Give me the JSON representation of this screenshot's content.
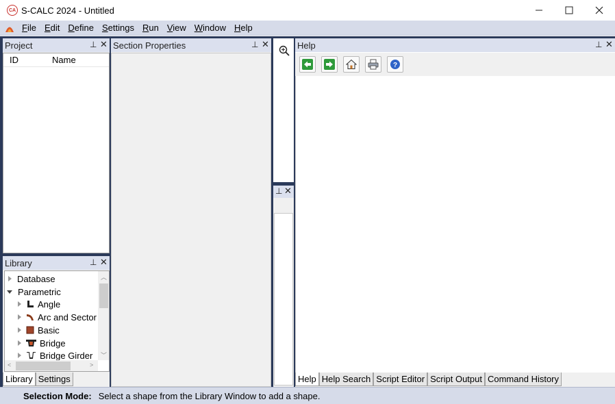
{
  "window": {
    "title": "S-CALC 2024 - Untitled",
    "minimize_glyph": "—",
    "maximize_glyph": "☐",
    "close_glyph": "✕"
  },
  "menu": {
    "items": [
      {
        "label": "File",
        "underline": "F",
        "rest": "ile"
      },
      {
        "label": "Edit",
        "underline": "E",
        "rest": "dit"
      },
      {
        "label": "Define",
        "underline": "D",
        "rest": "efine"
      },
      {
        "label": "Settings",
        "underline": "S",
        "rest": "ettings"
      },
      {
        "label": "Run",
        "underline": "R",
        "rest": "un"
      },
      {
        "label": "View",
        "underline": "V",
        "rest": "iew"
      },
      {
        "label": "Window",
        "underline": "W",
        "rest": "indow"
      },
      {
        "label": "Help",
        "underline": "H",
        "rest": "elp"
      }
    ]
  },
  "project": {
    "title": "Project",
    "columns": [
      "ID",
      "Name"
    ]
  },
  "library": {
    "title": "Library",
    "tree": [
      {
        "label": "Database",
        "expanded": false,
        "level": 0,
        "icon": ""
      },
      {
        "label": "Parametric",
        "expanded": true,
        "level": 0,
        "icon": ""
      },
      {
        "label": "Angle",
        "expanded": false,
        "level": 1,
        "icon": "angle-icon"
      },
      {
        "label": "Arc and Sector",
        "expanded": false,
        "level": 1,
        "icon": "arc-icon"
      },
      {
        "label": "Basic",
        "expanded": false,
        "level": 1,
        "icon": "basic-icon"
      },
      {
        "label": "Bridge",
        "expanded": false,
        "level": 1,
        "icon": "bridge-icon"
      },
      {
        "label": "Bridge Girder",
        "expanded": false,
        "level": 1,
        "icon": "bridge-girder-icon"
      }
    ],
    "tabs": [
      "Library",
      "Settings"
    ],
    "active_tab": "Library"
  },
  "section": {
    "title": "Section Properties"
  },
  "help": {
    "title": "Help",
    "toolbar": [
      "back-icon",
      "forward-icon",
      "home-icon",
      "print-icon",
      "help-icon"
    ],
    "tabs": [
      "Help",
      "Help Search",
      "Script Editor",
      "Script Output",
      "Command History"
    ],
    "active_tab": "Help"
  },
  "status": {
    "label": "Selection Mode:",
    "text": "Select a shape from the Library Window to add a shape."
  },
  "colors": {
    "dock_background": "#2b3a5a",
    "menu_background": "#d6dbe9",
    "panel_header": "#dbe0ee",
    "brand_red": "#c9302c"
  }
}
